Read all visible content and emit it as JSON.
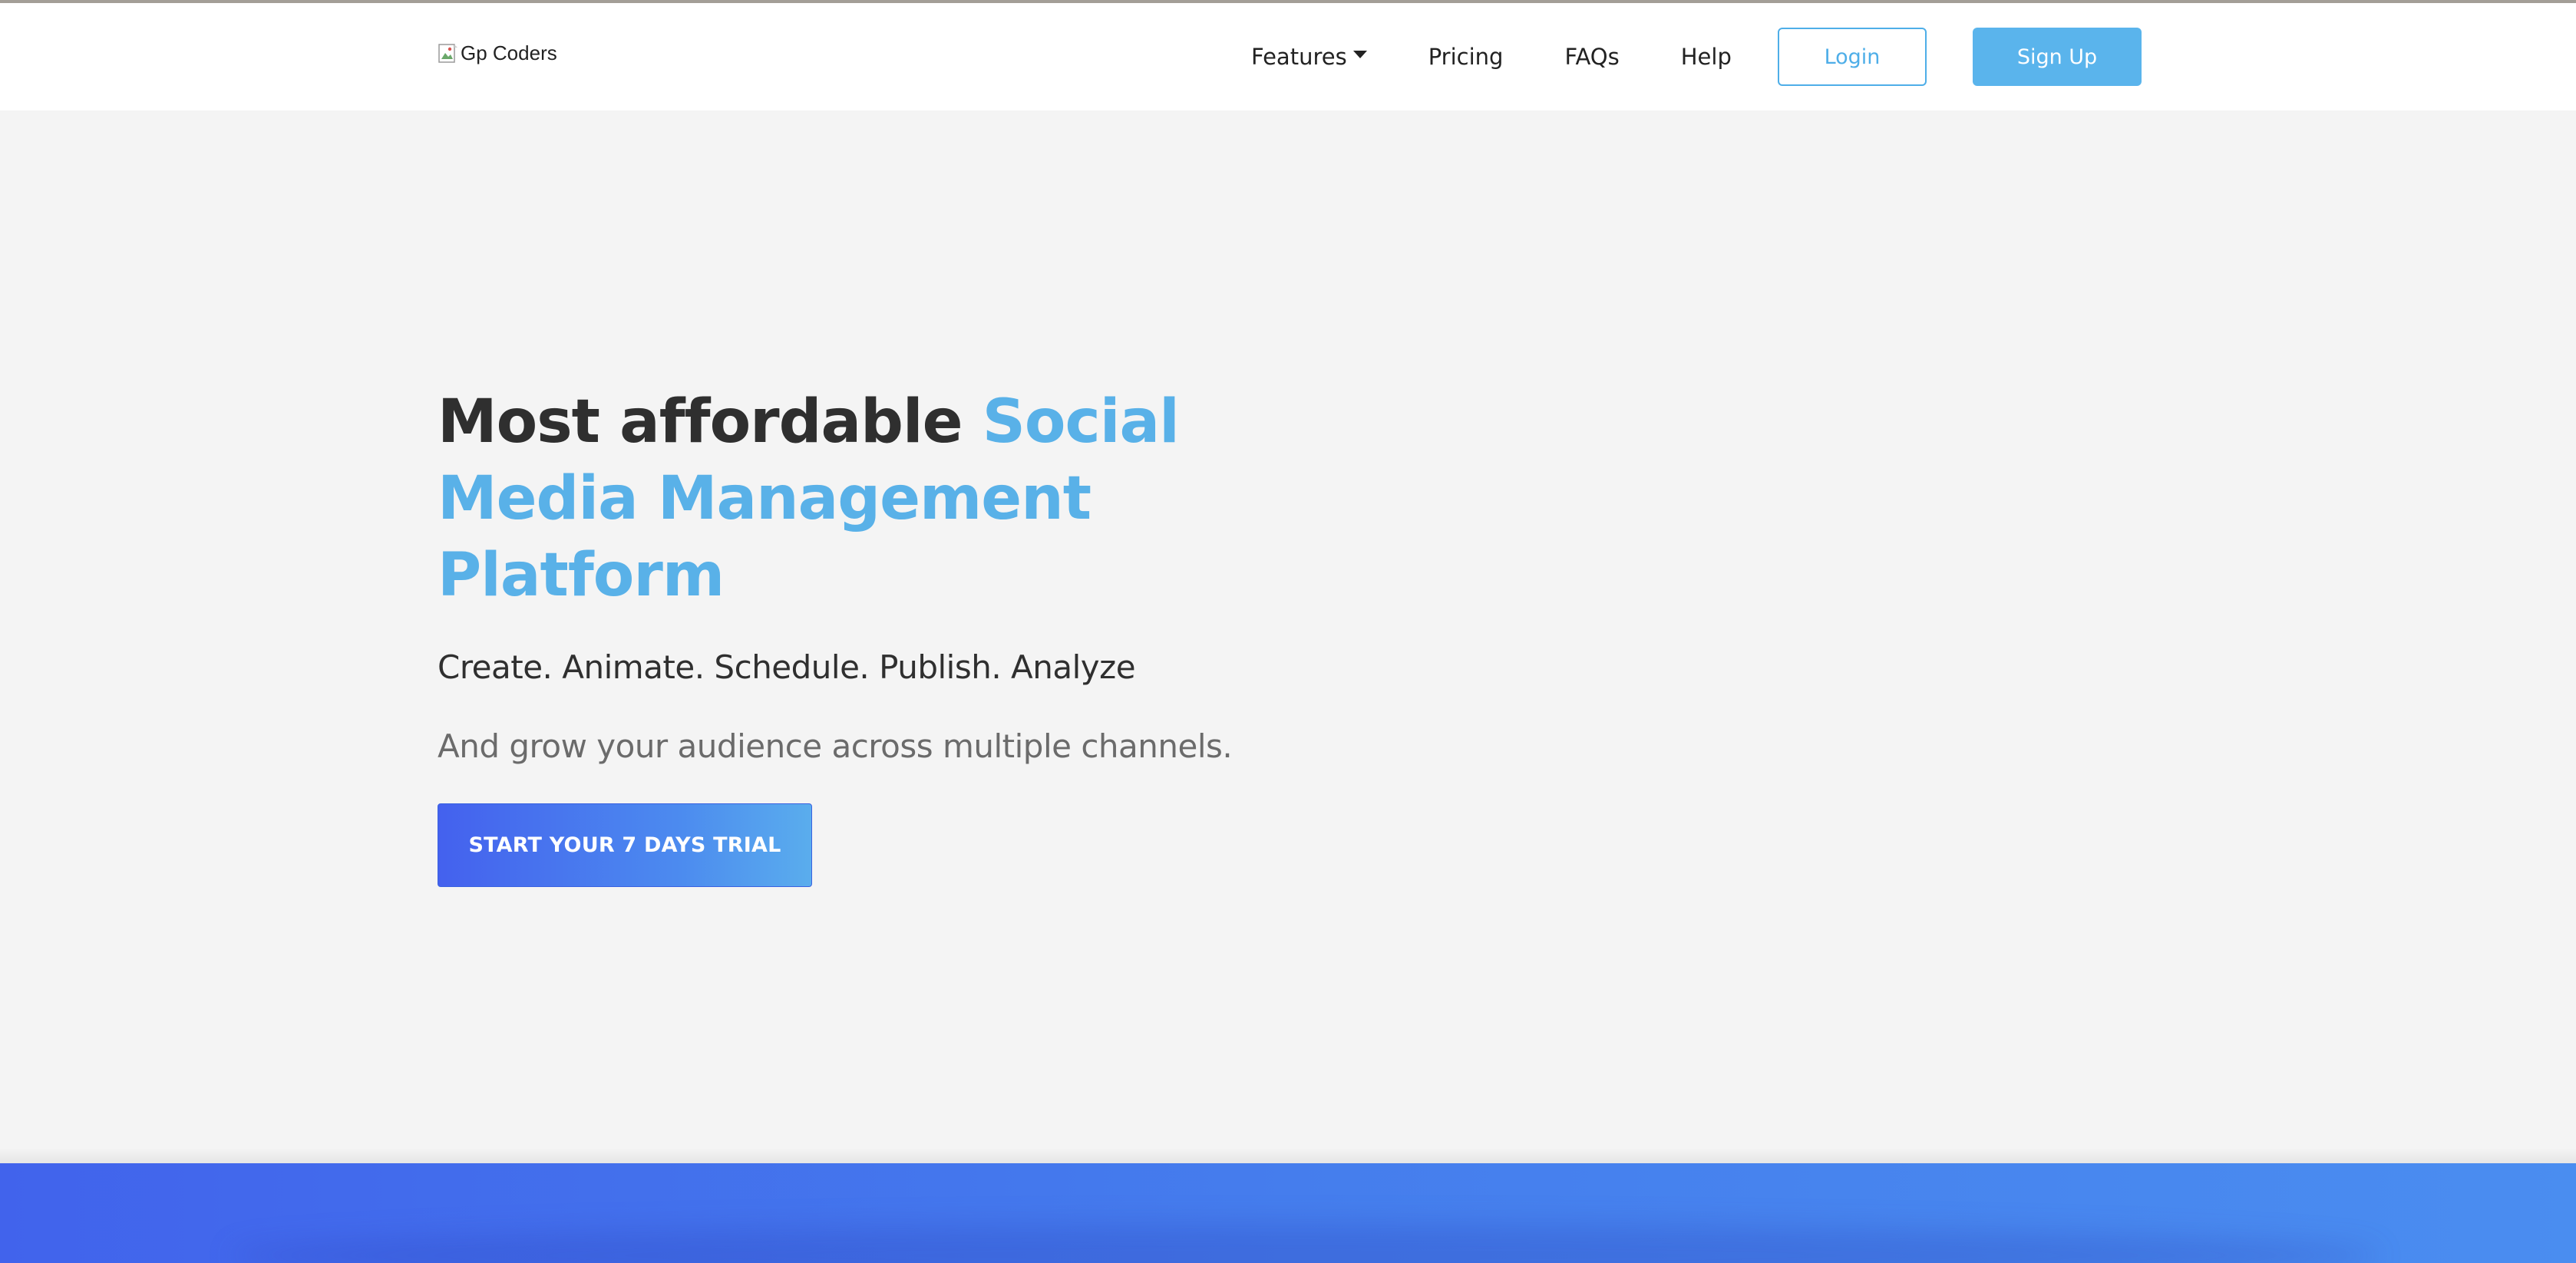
{
  "navbar": {
    "brand_alt": "Gp Coders",
    "links": {
      "features": "Features",
      "pricing": "Pricing",
      "faqs": "FAQs",
      "help": "Help"
    },
    "login_label": "Login",
    "signup_label": "Sign Up"
  },
  "hero": {
    "title_plain": "Most affordable ",
    "title_accent": "Social Media Management Platform",
    "subtitle": "Create. Animate. Schedule. Publish. Analyze",
    "description": "And grow your audience across multiple channels.",
    "cta_label": "START YOUR 7 DAYS TRIAL"
  },
  "colors": {
    "accent": "#59b1e8",
    "login_border": "#4eaee8",
    "signup_bg": "#5ab4ec",
    "cta_gradient_start": "#4461ee",
    "cta_gradient_end": "#5aaded",
    "page_bg": "#f4f4f4",
    "band_start": "#4163ec",
    "band_end": "#4a8df0"
  },
  "icons": {
    "brand": "broken-image-icon",
    "features_dropdown": "caret-down-icon"
  }
}
